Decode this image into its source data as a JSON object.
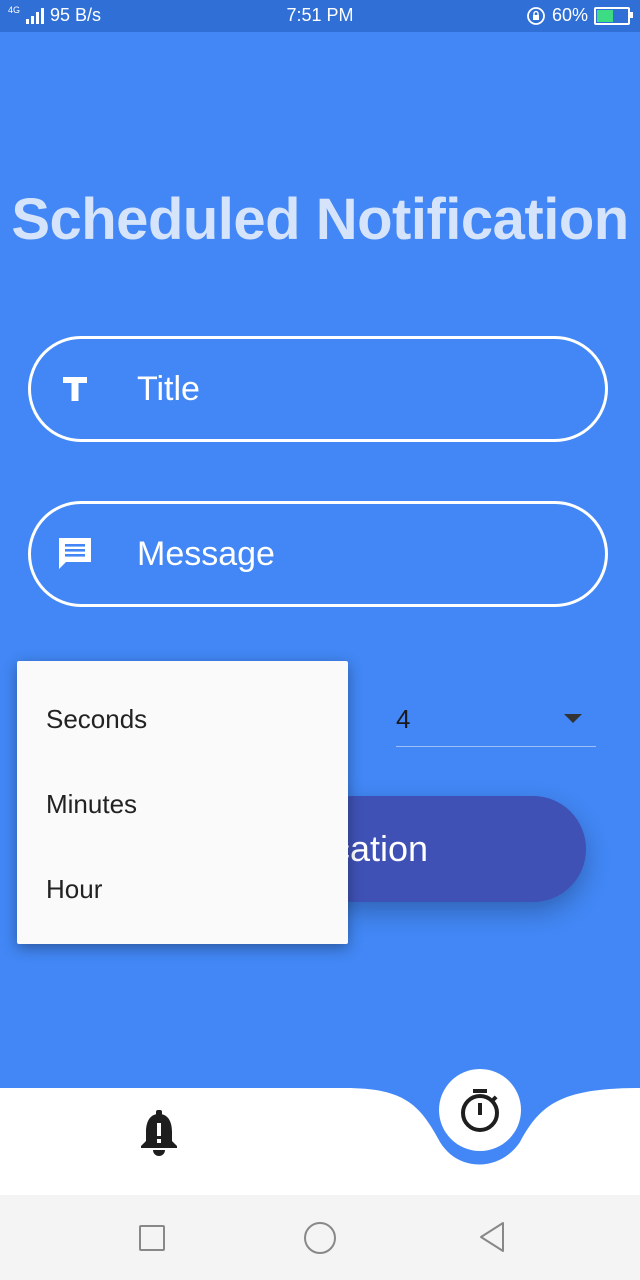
{
  "status_bar": {
    "network_type": "4G",
    "speed": "95 B/s",
    "time": "7:51 PM",
    "battery": "60%",
    "battery_level": 0.6,
    "battery_color": "#3ddc84"
  },
  "page": {
    "title": "Scheduled Notification",
    "background_color": "#4287f5"
  },
  "form": {
    "title_field": {
      "placeholder": "Title",
      "value": "",
      "icon": "text-format-icon"
    },
    "message_field": {
      "placeholder": "Message",
      "value": "",
      "icon": "message-icon"
    },
    "amount_select": {
      "value": "4"
    },
    "unit_dropdown": {
      "options": [
        "Seconds",
        "Minutes",
        "Hour"
      ]
    },
    "schedule_button": {
      "label_visible": "ication"
    }
  },
  "bottom_nav": {
    "items": [
      {
        "name": "notifications",
        "icon": "bell-icon"
      },
      {
        "name": "timer",
        "icon": "stopwatch-icon",
        "selected": true
      }
    ]
  },
  "system_nav": {
    "icons": [
      "recent-apps-icon",
      "home-icon",
      "back-icon"
    ]
  }
}
